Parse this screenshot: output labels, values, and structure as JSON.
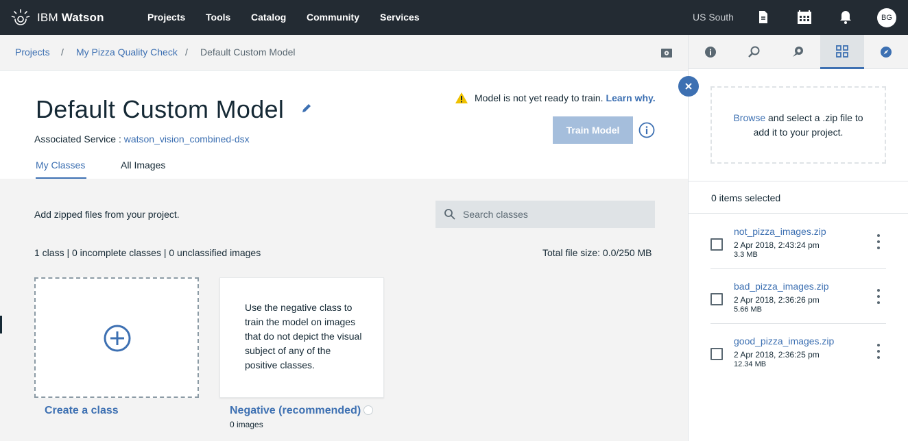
{
  "nav": {
    "brand_prefix": "IBM",
    "brand_name": "Watson",
    "menu": [
      "Projects",
      "Tools",
      "Catalog",
      "Community",
      "Services"
    ],
    "region": "US South",
    "avatar_initials": "BG"
  },
  "breadcrumb": {
    "items": [
      "Projects",
      "My Pizza Quality Check",
      "Default Custom Model"
    ],
    "separator": "/"
  },
  "header": {
    "title": "Default Custom Model",
    "service_label": "Associated Service :",
    "service_name": "watson_vision_combined-dsx",
    "warning_text": "Model is not yet ready to train.",
    "warning_link": "Learn why.",
    "train_button": "Train Model",
    "tabs": [
      "My Classes",
      "All Images"
    ]
  },
  "content": {
    "add_text": "Add zipped files from your project.",
    "search_placeholder": "Search classes",
    "counts_text": "1 class | 0 incomplete classes | 0 unclassified images",
    "total_size": "Total file size: 0.0/250 MB",
    "create_label": "Create a class",
    "negative_description": "Use the negative class to train the model on images that do not depict the visual subject of any of the positive classes.",
    "negative_label": "Negative (recommended)",
    "negative_count": "0 images"
  },
  "panel": {
    "browse_link": "Browse",
    "browse_text_1": " and select a .zip file to",
    "browse_text_2": "add it to your project.",
    "selected_text": "0 items selected",
    "files": [
      {
        "name": "not_pizza_images.zip",
        "date": "2 Apr 2018, 2:43:24 pm",
        "size": "3.3 MB"
      },
      {
        "name": "bad_pizza_images.zip",
        "date": "2 Apr 2018, 2:36:26 pm",
        "size": "5.66 MB"
      },
      {
        "name": "good_pizza_images.zip",
        "date": "2 Apr 2018, 2:36:25 pm",
        "size": "12.34 MB"
      }
    ]
  },
  "colors": {
    "nav_bg": "#232b33",
    "accent": "#3d70b2",
    "train_disabled": "#a5bedc",
    "warning": "#efc100"
  }
}
